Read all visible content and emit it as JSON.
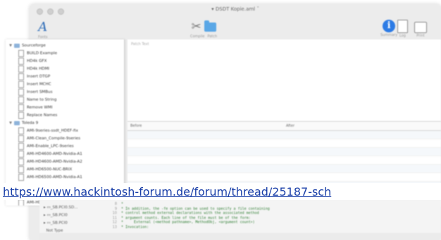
{
  "window": {
    "title": "▾ DSDT Kopie.aml ˇ"
  },
  "toolbar": {
    "left": {
      "label": "Fonts"
    },
    "center_left_label": "Compile",
    "center_right_label": "Patch",
    "right_labels": [
      "Summary",
      "Log",
      "Print"
    ]
  },
  "sidebar": {
    "groups": [
      {
        "label": "Sourceforge",
        "items": [
          "BUILD Example",
          "HD4k GFX",
          "HD4k HDMI",
          "Insert DTGP",
          "Insert MCHC",
          "Insert SMBus",
          "Name to String",
          "Remove WMI",
          "Replace Names"
        ]
      },
      {
        "label": "Toleda 9",
        "items": [
          "AMI-9series-ssdt_HDEF-fix",
          "AMI-Clean_Compile-9series",
          "AMI-Enable_LPC-9series",
          "AMI-HD4600-AMD-Nvidia-A1",
          "AMI-HD4600-AMD-Nvidia-A2",
          "AMI-HD6500-NUC-BRIX",
          "AMI-HD6500-AMD-Nvidia-A1",
          "AMI-HD6500-NUC-BRIX"
        ]
      }
    ]
  },
  "patch": {
    "placeholder": "Patch Text"
  },
  "table": {
    "columns": [
      "Before",
      "After"
    ]
  },
  "editor": {
    "items": [
      "_SB.PCI0.SD...",
      "_SB.PCI0",
      "_SB.PCI0",
      "Not Type"
    ],
    "lines": [
      "*",
      "* In addition, the -fe option can be used to specify a file containing",
      "* control method external declarations with the associated method",
      "* argument counts. Each line of the file must be of the form:",
      "*     External (<method pathname>, MethodObj, <argument count>)",
      "* Invocation:"
    ]
  },
  "link": {
    "text": "https://www.hackintosh-forum.de/forum/thread/25187-sch"
  },
  "colors": {
    "link": "#1a3fa8",
    "accent": "#2c7be5",
    "comment": "#2e7d32"
  }
}
